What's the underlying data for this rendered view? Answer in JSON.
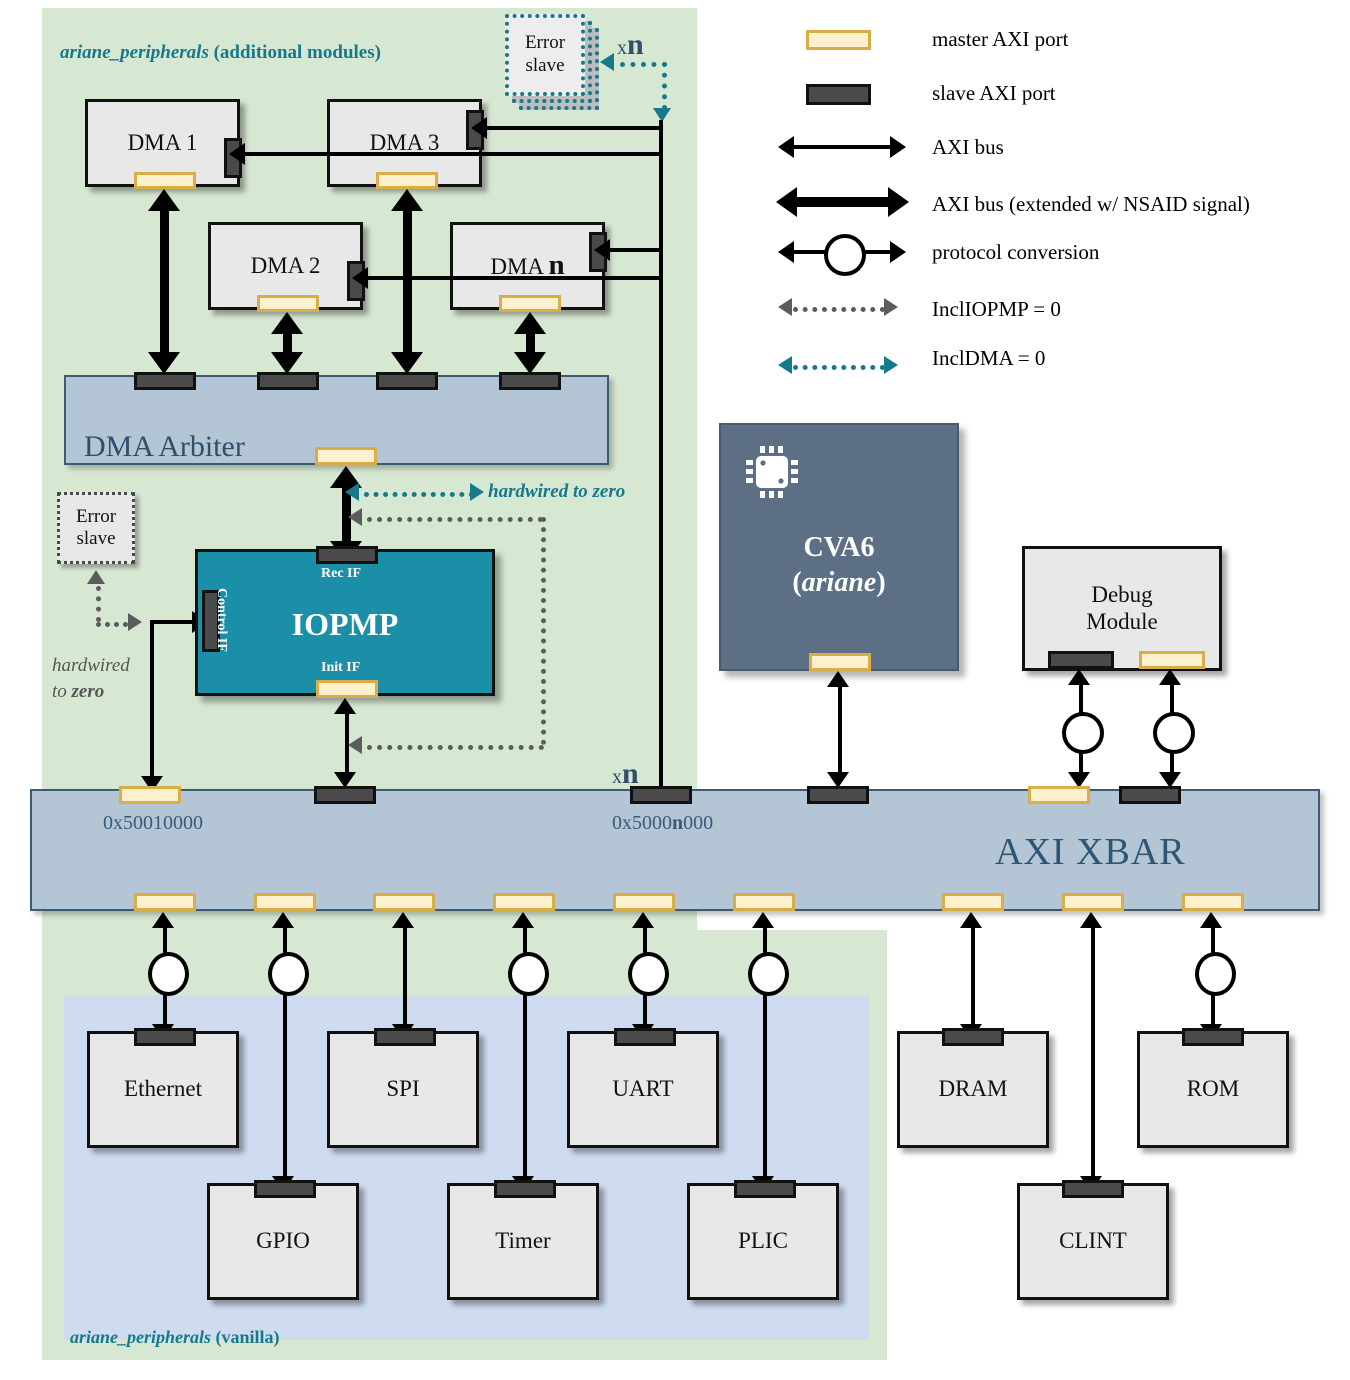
{
  "regions": {
    "additional": {
      "label_em": "ariane_peripherals",
      "label_rest": " (additional modules)"
    },
    "vanilla": {
      "label_em": "ariane_peripherals",
      "label_rest": " (vanilla)"
    }
  },
  "legend": {
    "items": [
      {
        "key": "master-axi-port",
        "label": "master AXI port",
        "kind": "port-master"
      },
      {
        "key": "slave-axi-port",
        "label": "slave AXI port",
        "kind": "port-slave"
      },
      {
        "key": "axi-bus",
        "label": "AXI bus",
        "kind": "arrow"
      },
      {
        "key": "axi-bus-nsaid",
        "label": "AXI bus (extended w/ NSAID signal)",
        "kind": "arrow-thick"
      },
      {
        "key": "protocol-conv",
        "label": "protocol conversion",
        "kind": "arrow-circle"
      },
      {
        "key": "incl-iopmp",
        "label": "InclIOPMP = 0",
        "kind": "dotted-gray"
      },
      {
        "key": "incl-dma",
        "label": "InclDMA = 0",
        "kind": "dotted-teal"
      }
    ]
  },
  "blocks": {
    "dma1": {
      "label": "DMA 1"
    },
    "dma2": {
      "label": "DMA 2"
    },
    "dma3": {
      "label": "DMA 3"
    },
    "dman": {
      "label": "DMA ",
      "label_bold": "n"
    },
    "arbiter": {
      "label": "DMA Arbiter"
    },
    "iopmp": {
      "label": "IOPMP",
      "rec_if": "Rec IF",
      "init_if": "Init IF",
      "control_if": "Control IF"
    },
    "xbar": {
      "label": "AXI XBAR"
    },
    "cva6": {
      "label": "CVA6",
      "sublabel": "ariane"
    },
    "debug": {
      "label": "Debug\nModule",
      "line1": "Debug",
      "line2": "Module"
    },
    "err_top": {
      "label": "Error\nslave",
      "line1": "Error",
      "line2": "slave"
    },
    "err_left": {
      "label": "Error\nslave",
      "line1": "Error",
      "line2": "slave"
    },
    "ethernet": {
      "label": "Ethernet"
    },
    "spi": {
      "label": "SPI"
    },
    "uart": {
      "label": "UART"
    },
    "gpio": {
      "label": "GPIO"
    },
    "timer": {
      "label": "Timer"
    },
    "plic": {
      "label": "PLIC"
    },
    "dram": {
      "label": "DRAM"
    },
    "clint": {
      "label": "CLINT"
    },
    "rom": {
      "label": "ROM"
    }
  },
  "annotations": {
    "hardwired_zero_teal": {
      "text": "hardwired to ",
      "bold": "zero"
    },
    "hardwired_zero_gray1": {
      "line1": "hardwired",
      "line2_pre": "to ",
      "line2_bold": "zero"
    },
    "xn_top": {
      "pre": "x",
      "bold": "n"
    },
    "xn_xbar": {
      "pre": "x",
      "bold": "n"
    },
    "addr_iopmp": "0x50010000",
    "addr_dman": {
      "pre": "0x5000",
      "bold": "n",
      "post": "000"
    }
  },
  "colors": {
    "region_green": "#d7e8d2",
    "region_blue": "#cfdcf0",
    "iopmp_teal": "#1b8fa8",
    "cva6_slate": "#5d6f85",
    "bus_blue": "#b4c6d6",
    "port_master": "#fdf0cd",
    "port_master_border": "#d9ad4a",
    "port_slave": "#4a4a4a",
    "accent_teal": "#15788c",
    "dotted_gray": "#5c5c5c"
  }
}
